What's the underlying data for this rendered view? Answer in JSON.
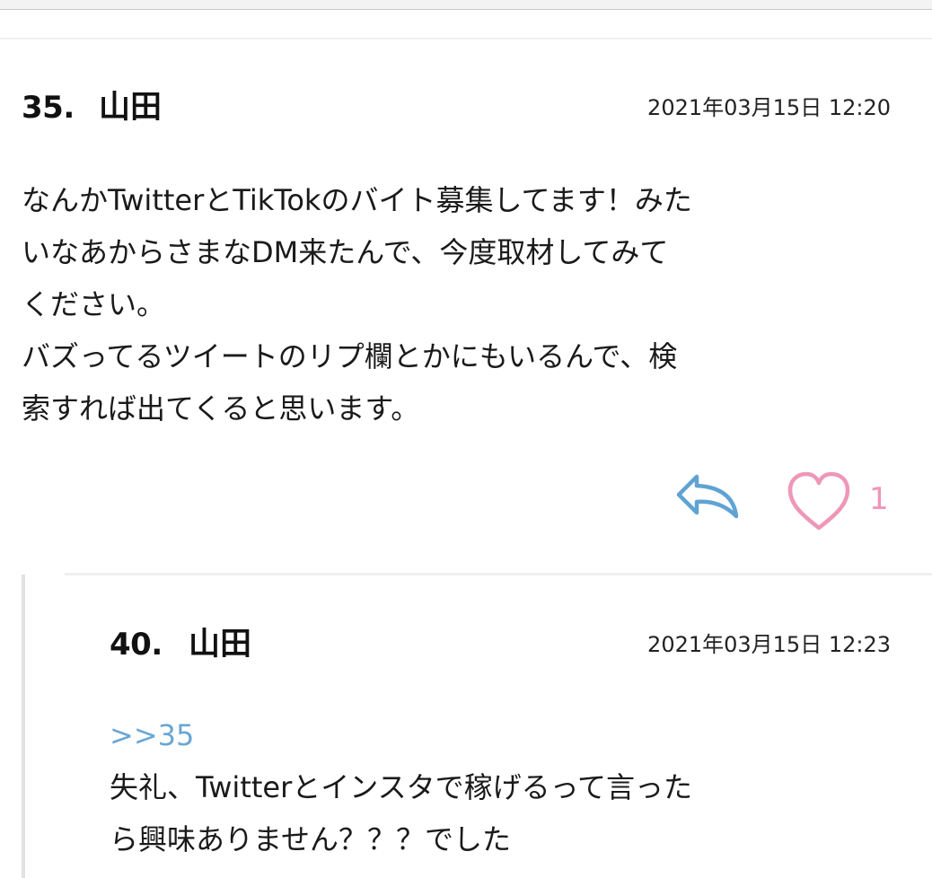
{
  "posts": [
    {
      "number": "35.",
      "name": "山田",
      "date": "2021年03月15日 12:20",
      "body_lines": [
        "なんかTwitterとTikTokのバイト募集してます！みた",
        "いなあからさまなDM来たんで、今度取材してみて",
        "ください。",
        "バズってるツイートのリプ欄とかにもいるんで、検",
        "索すれば出てくると思います。"
      ],
      "likes": "1",
      "icons": {
        "reply": "reply-arrow-icon",
        "like": "heart-outline-icon"
      }
    },
    {
      "number": "40.",
      "name": "山田",
      "date": "2021年03月15日 12:23",
      "anchor": ">>35",
      "body_lines": [
        "失礼、Twitterとインスタで稼げるって言った",
        "ら興味ありません？？？でした"
      ]
    }
  ],
  "colors": {
    "reply_icon": "#5fa3d3",
    "like_icon": "#ee97b8",
    "anchor_link": "#6aa6d3"
  }
}
